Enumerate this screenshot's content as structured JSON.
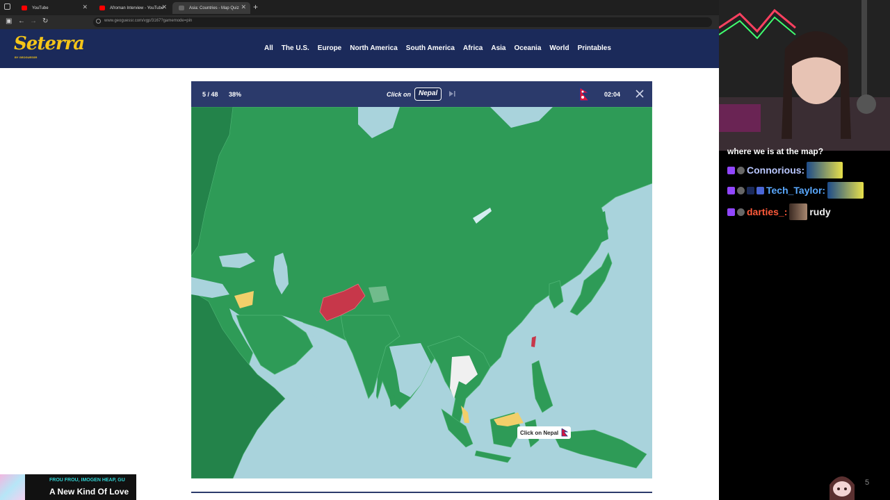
{
  "browser": {
    "tabs": [
      {
        "title": "YouTube",
        "favicon_color": "#ff0000"
      },
      {
        "title": "Afroman Interview - YouTube",
        "favicon_color": "#ff0000"
      },
      {
        "title": "Asia: Countries - Map Quiz",
        "favicon_color": "#555555"
      }
    ],
    "active_tab": 2,
    "url": "www.geoguessr.com/vgp/3167?gamemode=pin"
  },
  "site": {
    "logo": "Seterra",
    "logo_sub": "BY GEOGUESSR",
    "nav": [
      "All",
      "The U.S.",
      "Europe",
      "North America",
      "South America",
      "Africa",
      "Asia",
      "Oceania",
      "World",
      "Printables"
    ],
    "header_color": "#1b2a5a",
    "logo_color": "#f5c518"
  },
  "quiz": {
    "progress": "5 / 48",
    "percent": "38%",
    "prompt": "Click on",
    "target": "Nepal",
    "timer": "02:04",
    "tooltip": "Click on Nepal",
    "colors": {
      "land": "#2e9b57",
      "land_dark": "#23834a",
      "ocean": "#a9d3dc",
      "wrong": "#c7374a",
      "partial": "#f2cf6a",
      "unanswered": "#f0f0f0"
    }
  },
  "music": {
    "artist": "FROU FROU, IMOGEN HEAP, GU",
    "title": "A New Kind Of Love"
  },
  "chat": {
    "cut_line": "where we is at the map?",
    "messages": [
      {
        "user": "Connorious:",
        "color": "#b9c7ff",
        "text": ""
      },
      {
        "user": "Tech_Taylor:",
        "color": "#5aa9ff",
        "text": ""
      },
      {
        "user": "darties_:",
        "color": "#ff5a3a",
        "text": "rudy"
      }
    ]
  },
  "page_number": "5"
}
